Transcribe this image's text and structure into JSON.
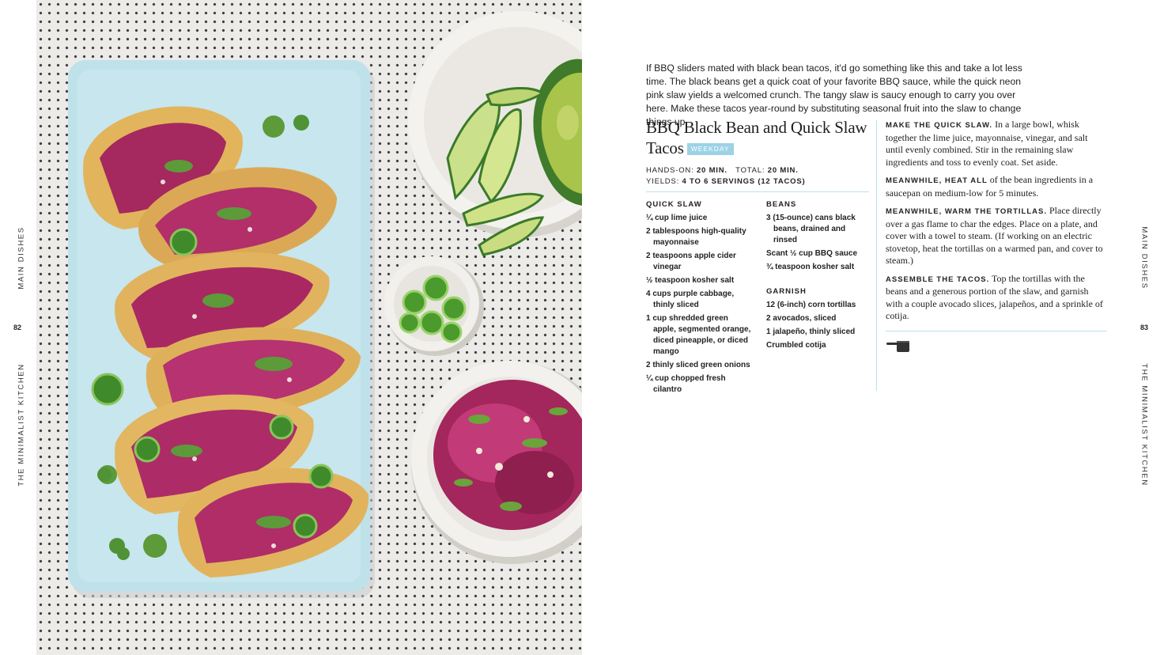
{
  "left_page": {
    "section": "MAIN DISHES",
    "page_number": "82",
    "book_title": "THE MINIMALIST KITCHEN"
  },
  "right_page": {
    "section": "MAIN DISHES",
    "page_number": "83",
    "book_title": "THE MINIMALIST KITCHEN"
  },
  "intro": "If BBQ sliders mated with black bean tacos, it'd go something like this and take a lot less time. The black beans get a quick coat of your favorite BBQ sauce, while the quick neon pink slaw yields a welcomed crunch. The tangy slaw is saucy enough to carry you over here. Make these tacos year-round by substituting seasonal fruit into the slaw to change things up.",
  "recipe": {
    "title": "BBQ Black Bean and Quick Slaw Tacos",
    "badge": "WEEKDAY",
    "hands_on_label": "HANDS-ON:",
    "hands_on_value": "20 MIN.",
    "total_label": "TOTAL:",
    "total_value": "20 MIN.",
    "yields_label": "YIELDS:",
    "yields_value": "4 TO 6 SERVINGS (12 TACOS)"
  },
  "ingredients": {
    "slaw_heading": "QUICK SLAW",
    "slaw": [
      "¼ cup lime juice",
      "2 tablespoons high-quality mayonnaise",
      "2 teaspoons apple cider vinegar",
      "½ teaspoon kosher salt",
      "4 cups purple cabbage, thinly sliced",
      "1 cup shredded green apple, segmented orange, diced pineapple, or diced mango",
      "2 thinly sliced green onions",
      "¼ cup chopped fresh cilantro"
    ],
    "beans_heading": "BEANS",
    "beans": [
      "3 (15-ounce) cans black beans, drained and rinsed",
      "Scant ½ cup BBQ sauce",
      "¾ teaspoon kosher salt"
    ],
    "garnish_heading": "GARNISH",
    "garnish": [
      "12 (6-inch) corn tortillas",
      "2 avocados, sliced",
      "1 jalapeño, thinly sliced",
      "Crumbled cotija"
    ]
  },
  "method": [
    {
      "lead": "MAKE THE QUICK SLAW.",
      "text": " In a large bowl, whisk together the lime juice, mayonnaise, vinegar, and salt until evenly combined. Stir in the remaining slaw ingredients and toss to evenly coat. Set aside."
    },
    {
      "lead": "MEANWHILE, HEAT ALL",
      "text": " of the bean ingredients in a saucepan on medium-low for 5 minutes."
    },
    {
      "lead": "MEANWHILE, WARM THE TORTILLAS.",
      "text": " Place directly over a gas flame to char the edges. Place on a plate, and cover with a towel to steam. (If working on an electric stovetop, heat the tortillas on a warmed pan, and cover to steam.)"
    },
    {
      "lead": "ASSEMBLE THE TACOS.",
      "text": " Top the tortillas with the beans and a generous portion of the slaw, and garnish with a couple avocado slices, jalapeños, and a sprinkle of cotija."
    }
  ],
  "icons": {
    "footer": "saucepan-icon"
  },
  "colors": {
    "accent": "#9cd2e6",
    "rule": "#b9e0ea"
  }
}
